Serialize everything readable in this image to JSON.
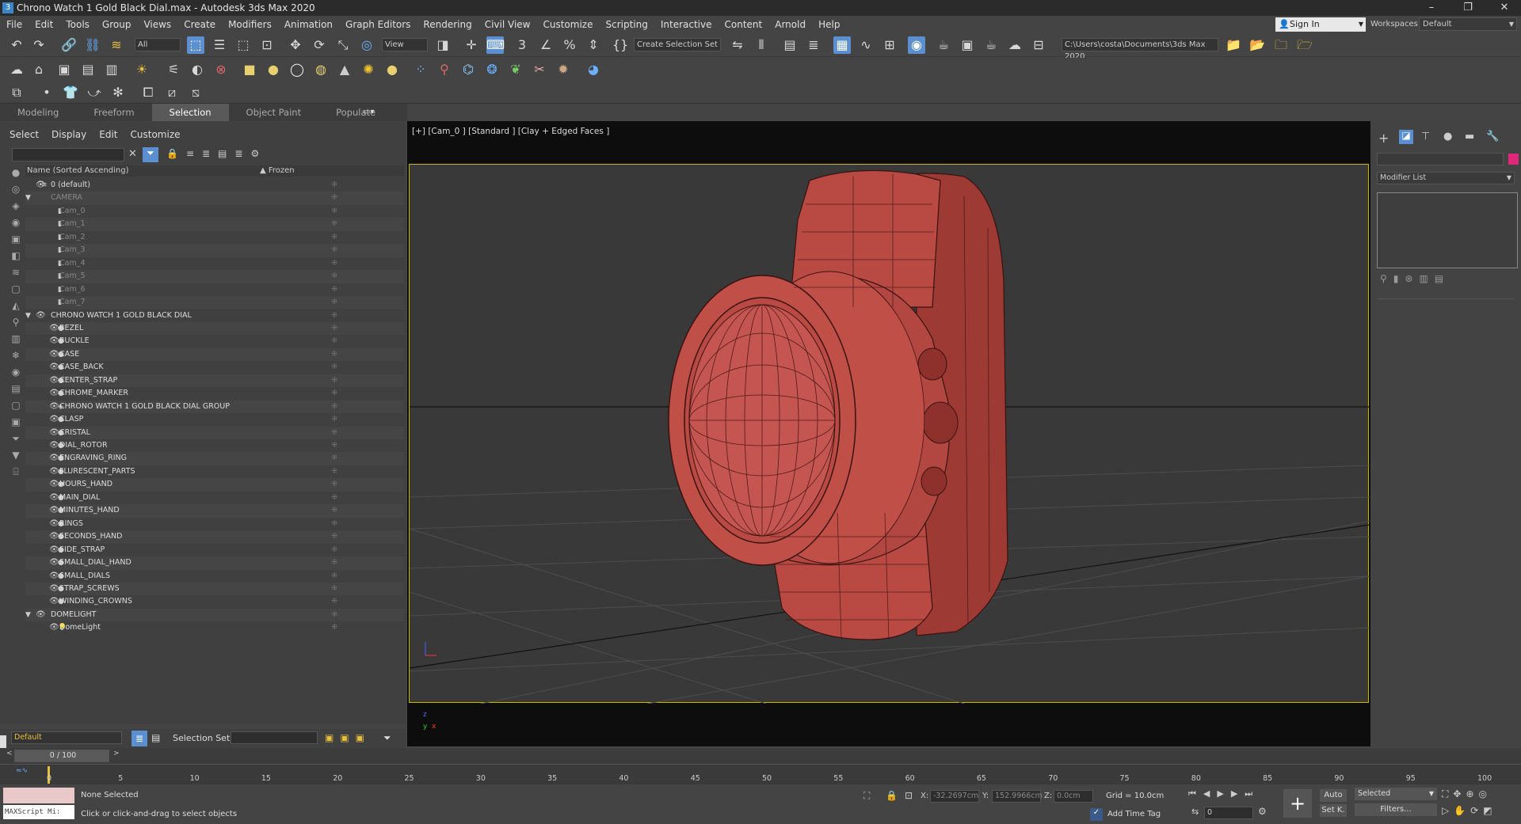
{
  "window": {
    "title": "Chrono Watch 1 Gold Black Dial.max - Autodesk 3ds Max 2020",
    "app_icon": "3"
  },
  "menubar": {
    "items": [
      "File",
      "Edit",
      "Tools",
      "Group",
      "Views",
      "Create",
      "Modifiers",
      "Animation",
      "Graph Editors",
      "Rendering",
      "Civil View",
      "Customize",
      "Scripting",
      "Interactive",
      "Content",
      "Arnold",
      "Help"
    ],
    "sign_in": "Sign In",
    "workspaces_label": "Workspaces:",
    "workspace_value": "Default"
  },
  "toolbar": {
    "filter_value": "All",
    "view_value": "View",
    "selection_set_placeholder": "Create Selection Set",
    "project_path": "C:\\Users\\costa\\Documents\\3ds Max 2020"
  },
  "ribbon_tabs": [
    "Modeling",
    "Freeform",
    "Selection",
    "Object Paint",
    "Populate"
  ],
  "scene_explorer": {
    "menu": [
      "Select",
      "Display",
      "Edit",
      "Customize"
    ],
    "col_name": "Name (Sorted Ascending)",
    "col_frozen": "▲ Frozen",
    "rows": [
      {
        "label": "0 (default)",
        "indent": 0,
        "grey": false,
        "kind": "layer"
      },
      {
        "label": "CAMERA",
        "indent": 0,
        "grey": true,
        "kind": "layer"
      },
      {
        "label": "Cam_0",
        "indent": 1,
        "grey": true,
        "kind": "cam"
      },
      {
        "label": "Cam_1",
        "indent": 1,
        "grey": true,
        "kind": "cam"
      },
      {
        "label": "Cam_2",
        "indent": 1,
        "grey": true,
        "kind": "cam"
      },
      {
        "label": "Cam_3",
        "indent": 1,
        "grey": true,
        "kind": "cam"
      },
      {
        "label": "Cam_4",
        "indent": 1,
        "grey": true,
        "kind": "cam"
      },
      {
        "label": "Cam_5",
        "indent": 1,
        "grey": true,
        "kind": "cam"
      },
      {
        "label": "Cam_6",
        "indent": 1,
        "grey": true,
        "kind": "cam"
      },
      {
        "label": "Cam_7",
        "indent": 1,
        "grey": true,
        "kind": "cam"
      },
      {
        "label": "CHRONO WATCH 1 GOLD BLACK DIAL",
        "indent": 0,
        "grey": false,
        "kind": "layer"
      },
      {
        "label": "BEZEL",
        "indent": 1,
        "grey": false,
        "kind": "obj"
      },
      {
        "label": "BUCKLE",
        "indent": 1,
        "grey": false,
        "kind": "obj"
      },
      {
        "label": "CASE",
        "indent": 1,
        "grey": false,
        "kind": "obj"
      },
      {
        "label": "CASE_BACK",
        "indent": 1,
        "grey": false,
        "kind": "obj"
      },
      {
        "label": "CENTER_STRAP",
        "indent": 1,
        "grey": false,
        "kind": "obj"
      },
      {
        "label": "CHROME_MARKER",
        "indent": 1,
        "grey": false,
        "kind": "obj"
      },
      {
        "label": "CHRONO WATCH 1 GOLD BLACK DIAL GROUP",
        "indent": 1,
        "grey": false,
        "kind": "group"
      },
      {
        "label": "CLASP",
        "indent": 1,
        "grey": false,
        "kind": "obj"
      },
      {
        "label": "CRISTAL",
        "indent": 1,
        "grey": false,
        "kind": "obj"
      },
      {
        "label": "DIAL_ROTOR",
        "indent": 1,
        "grey": false,
        "kind": "obj"
      },
      {
        "label": "ENGRAVING_RING",
        "indent": 1,
        "grey": false,
        "kind": "obj"
      },
      {
        "label": "FLURESCENT_PARTS",
        "indent": 1,
        "grey": false,
        "kind": "obj"
      },
      {
        "label": "HOURS_HAND",
        "indent": 1,
        "grey": false,
        "kind": "obj"
      },
      {
        "label": "MAIN_DIAL",
        "indent": 1,
        "grey": false,
        "kind": "obj"
      },
      {
        "label": "MINUTES_HAND",
        "indent": 1,
        "grey": false,
        "kind": "obj"
      },
      {
        "label": "RINGS",
        "indent": 1,
        "grey": false,
        "kind": "obj"
      },
      {
        "label": "SECONDS_HAND",
        "indent": 1,
        "grey": false,
        "kind": "obj"
      },
      {
        "label": "SIDE_STRAP",
        "indent": 1,
        "grey": false,
        "kind": "obj"
      },
      {
        "label": "SMALL_DIAL_HAND",
        "indent": 1,
        "grey": false,
        "kind": "obj"
      },
      {
        "label": "SMALL_DIALS",
        "indent": 1,
        "grey": false,
        "kind": "obj"
      },
      {
        "label": "STRAP_SCREWS",
        "indent": 1,
        "grey": false,
        "kind": "obj"
      },
      {
        "label": "WINDING_CROWNS",
        "indent": 1,
        "grey": false,
        "kind": "obj"
      },
      {
        "label": "DOMELIGHT",
        "indent": 0,
        "grey": false,
        "kind": "layer"
      },
      {
        "label": "DomeLight",
        "indent": 1,
        "grey": false,
        "kind": "light"
      }
    ]
  },
  "layer_bar": {
    "layer_value": "Default",
    "selection_set_label": "Selection Set:"
  },
  "viewport": {
    "label": "[+] [Cam_0 ] [Standard ] [Clay + Edged Faces ]",
    "axis_z": "z",
    "axis_x": "x",
    "axis_y": "y",
    "mesh_color": "#b94a43"
  },
  "command_panel": {
    "modifier_list": "Modifier List",
    "color_swatch": "#e0287a"
  },
  "timeline": {
    "frame_counter": "0 / 100",
    "ticks": [
      "0",
      "5",
      "10",
      "15",
      "20",
      "25",
      "30",
      "35",
      "40",
      "45",
      "50",
      "55",
      "60",
      "65",
      "70",
      "75",
      "80",
      "85",
      "90",
      "95",
      "100"
    ]
  },
  "status": {
    "maxscript": "MAXScript Mi:",
    "selected": "None Selected",
    "prompt": "Click or click-and-drag to select objects",
    "x_label": "X:",
    "x_value": "-32.2697cm",
    "y_label": "Y:",
    "y_value": "152.9966cm",
    "z_label": "Z:",
    "z_value": "0.0cm",
    "grid": "Grid = 10.0cm",
    "add_time_tag": "Add Time Tag",
    "auto": "Auto",
    "set_k": "Set K.",
    "key_mode": "Selected",
    "filters": "Filters...",
    "frame": "0"
  }
}
